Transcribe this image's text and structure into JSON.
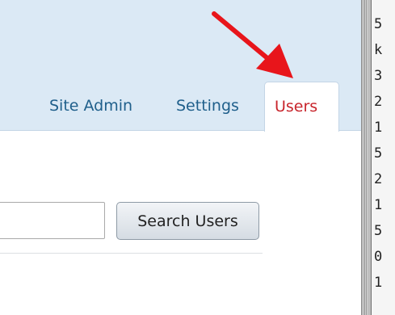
{
  "nav": {
    "site_admin": "Site Admin",
    "settings": "Settings",
    "users": "Users"
  },
  "search": {
    "input_value": "",
    "button_label": "Search Users"
  },
  "background_window": {
    "line_fragments": [
      "5",
      "k",
      "3",
      "2",
      "1",
      "5",
      "2",
      "1",
      "5",
      "0",
      "1"
    ]
  },
  "annotation": {
    "arrow_color": "#e8151b"
  },
  "colors": {
    "header_bg": "#dbe9f5",
    "link": "#1f5f8b",
    "active_tab_text": "#c8252c"
  }
}
